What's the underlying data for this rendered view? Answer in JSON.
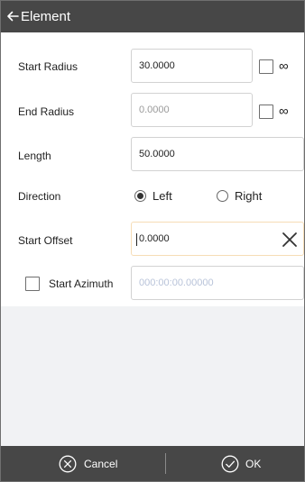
{
  "header": {
    "title": "Element",
    "back_icon": "arrow-left-icon"
  },
  "form": {
    "start_radius": {
      "label": "Start Radius",
      "value": "30.0000",
      "infinity_symbol": "∞",
      "infinity_checked": false
    },
    "end_radius": {
      "label": "End Radius",
      "value": "0.0000",
      "infinity_symbol": "∞",
      "infinity_checked": false
    },
    "length": {
      "label": "Length",
      "value": "50.0000"
    },
    "direction": {
      "label": "Direction",
      "options": [
        "Left",
        "Right"
      ],
      "selected": "Left"
    },
    "start_offset": {
      "label": "Start Offset",
      "value": "0.0000",
      "clear_icon": "close-icon"
    },
    "start_azimuth": {
      "label": "Start Azimuth",
      "checked": false,
      "placeholder": "000:00:00.00000"
    }
  },
  "footer": {
    "cancel_label": "Cancel",
    "cancel_icon": "circle-x-icon",
    "ok_label": "OK",
    "ok_icon": "circle-check-icon"
  },
  "colors": {
    "header_bg": "#474747",
    "footer_bg": "#474747",
    "empty_area_bg": "#f1f2f4",
    "focus_border": "#f6ddb6"
  }
}
